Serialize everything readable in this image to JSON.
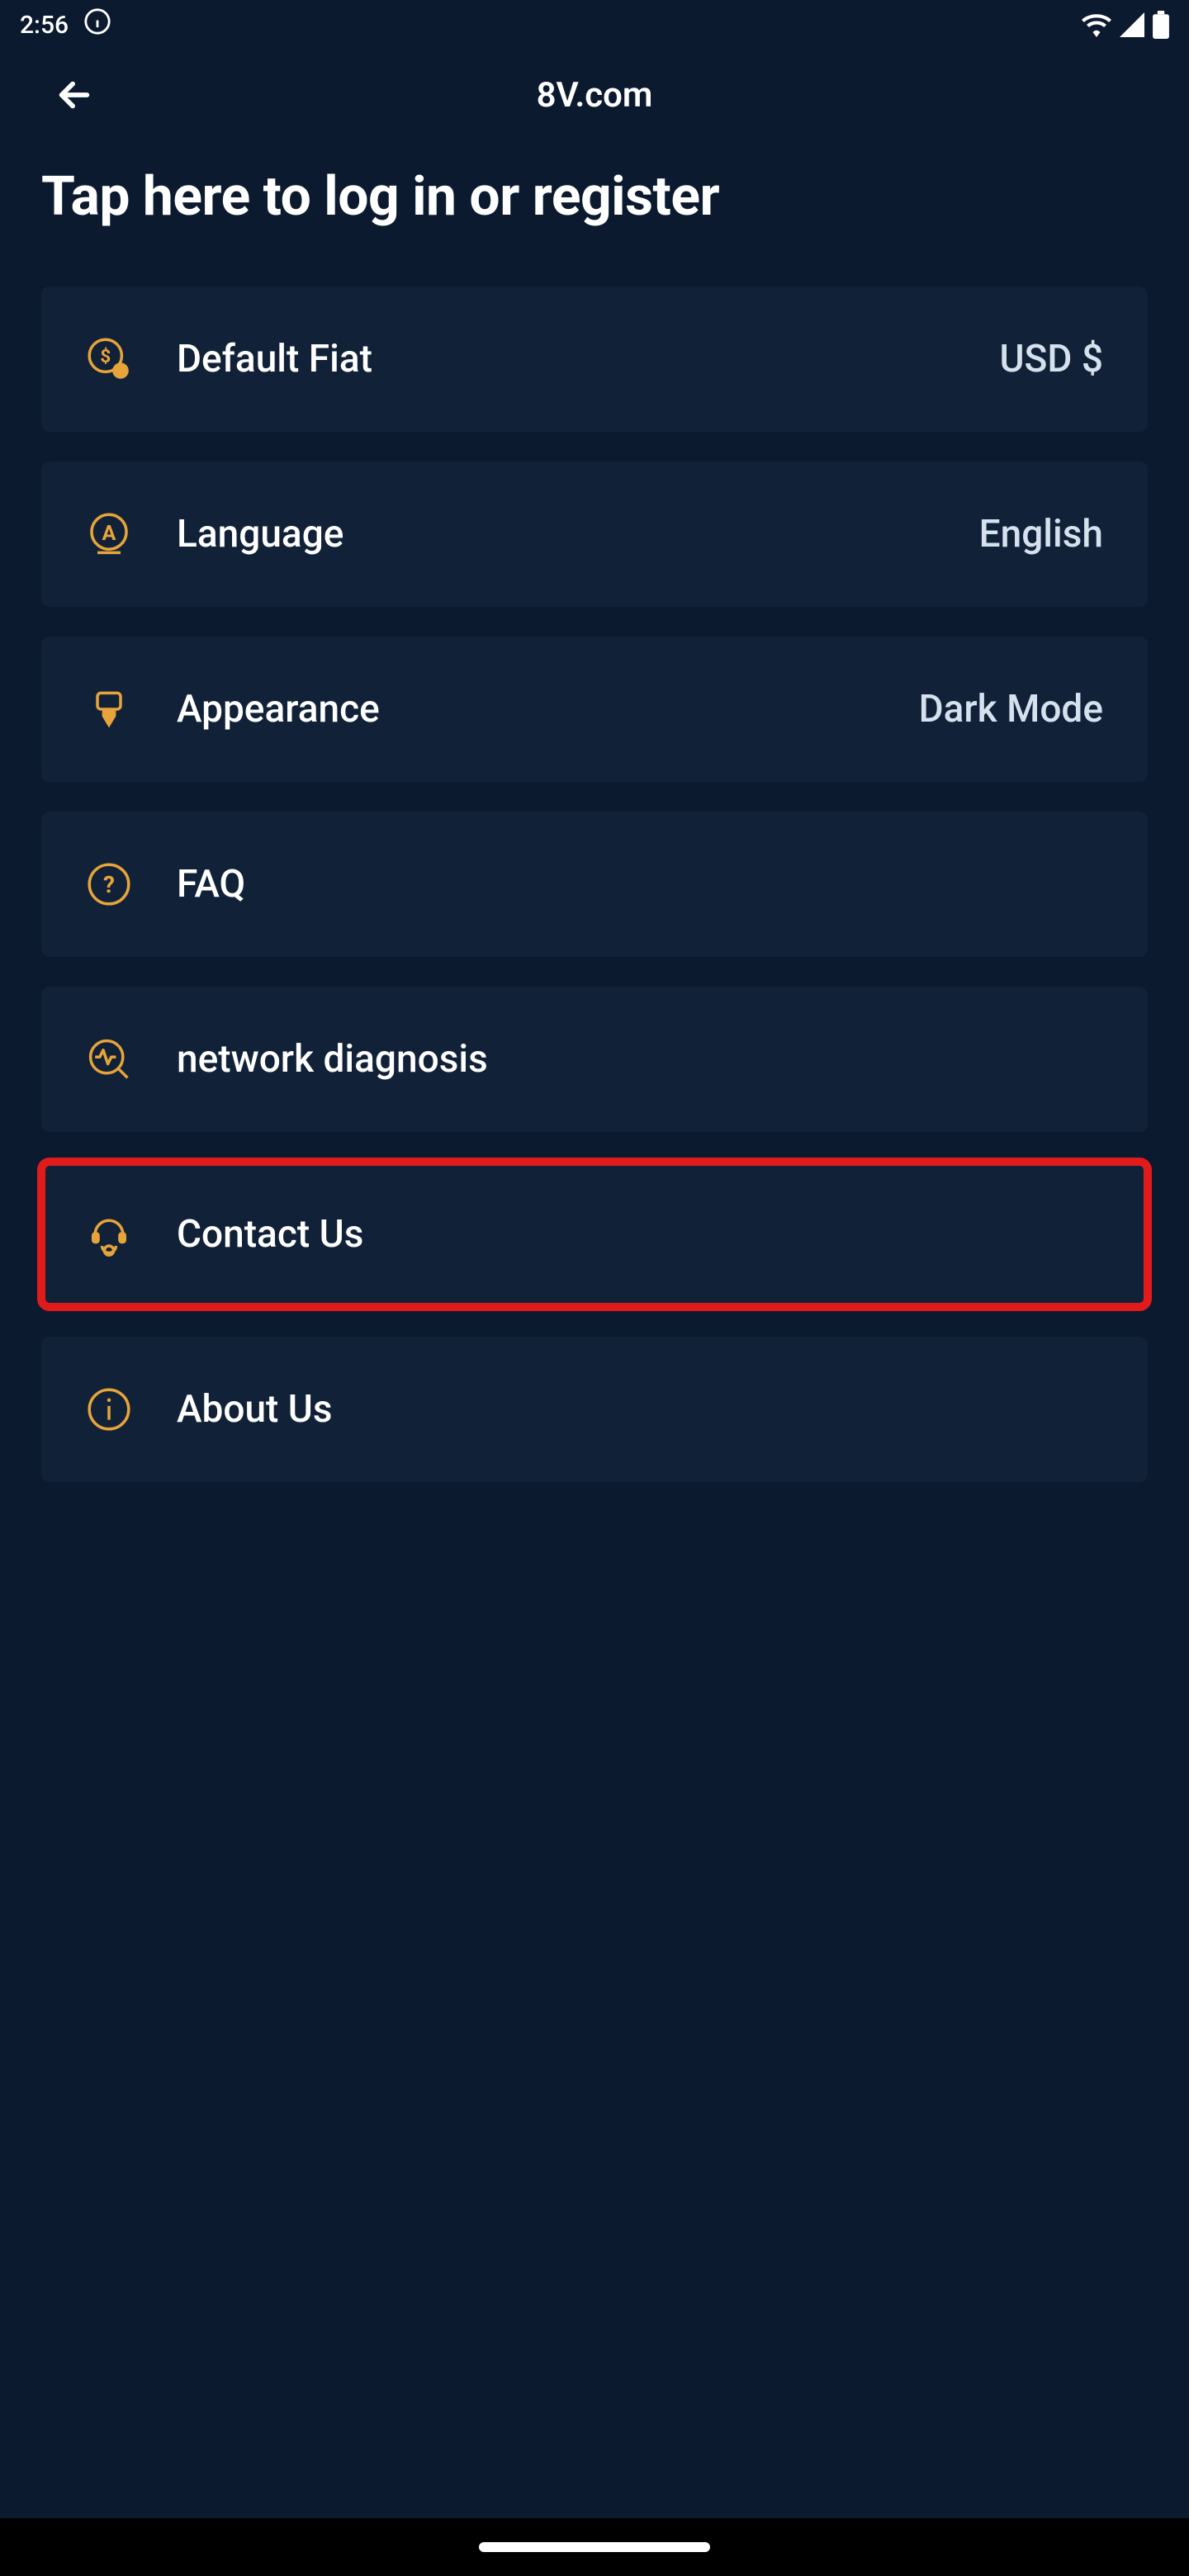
{
  "status": {
    "time": "2:56",
    "icons": {
      "info": "info-icon",
      "wifi": "wifi-icon",
      "signal": "signal-icon",
      "battery": "battery-icon"
    }
  },
  "header": {
    "title": "8V.com"
  },
  "login_prompt": "Tap here to log in or register",
  "menu": [
    {
      "icon": "dollar-circle-icon",
      "label": "Default Fiat",
      "value": "USD $",
      "highlight": false
    },
    {
      "icon": "language-a-icon",
      "label": "Language",
      "value": "English",
      "highlight": false
    },
    {
      "icon": "paint-brush-icon",
      "label": "Appearance",
      "value": "Dark Mode",
      "highlight": false
    },
    {
      "icon": "question-circle-icon",
      "label": "FAQ",
      "value": "",
      "highlight": false
    },
    {
      "icon": "network-pulse-icon",
      "label": "network diagnosis",
      "value": "",
      "highlight": false
    },
    {
      "icon": "headset-icon",
      "label": "Contact Us",
      "value": "",
      "highlight": true
    },
    {
      "icon": "info-circle-icon",
      "label": "About Us",
      "value": "",
      "highlight": false
    }
  ],
  "colors": {
    "bg": "#0b1a2e",
    "card": "#112238",
    "accent": "#e7a43a",
    "highlight_border": "#e11b1b"
  }
}
